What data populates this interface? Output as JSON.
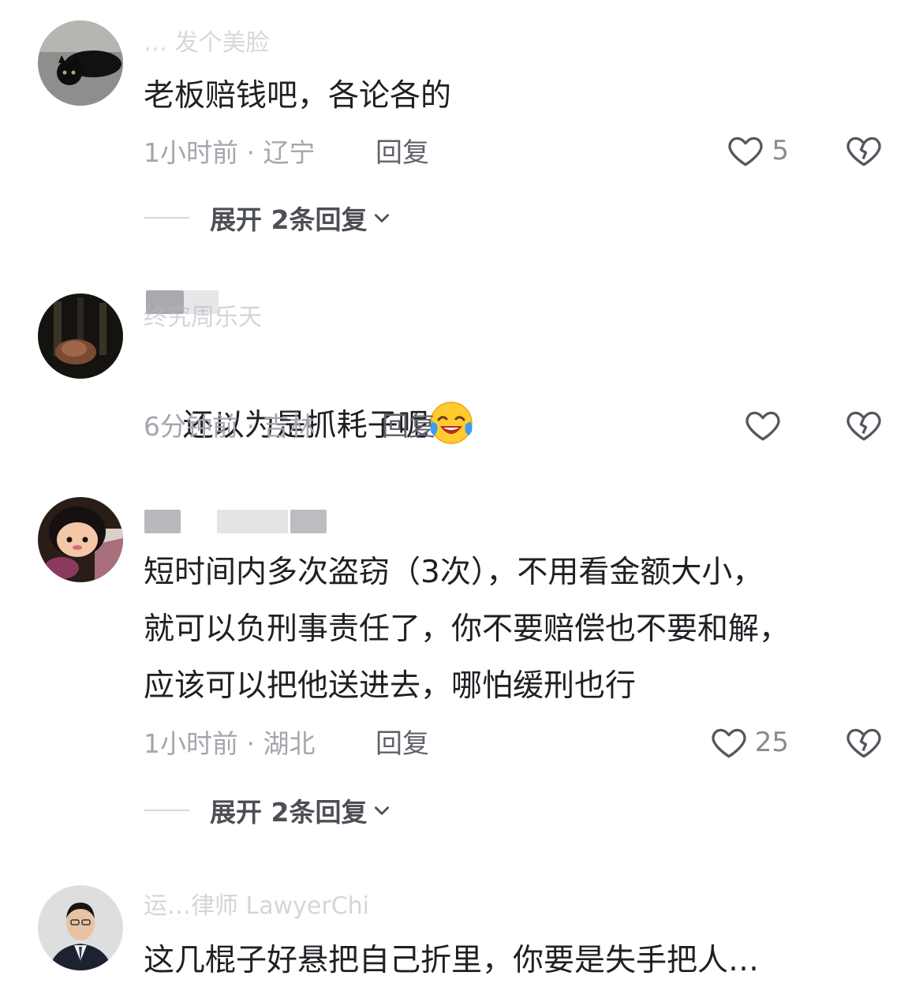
{
  "comments": [
    {
      "username": "… 发个美脸",
      "text": "老板赔钱吧，各论各的",
      "time_location": "1小时前 · 辽宁",
      "reply_label": "回复",
      "likes": "5",
      "expand_label": "展开 2条回复"
    },
    {
      "username": "终究周乐天",
      "text": "还以为是抓耗子呢",
      "emoji": "face-crying-laughing",
      "time_location": "6分钟前 · 吉林",
      "reply_label": "回复",
      "likes": ""
    },
    {
      "username": "",
      "text": "短时间内多次盗窃（3次），不用看金额大小，\n就可以负刑事责任了，你不要赔偿也不要和解，\n应该可以把他送进去，哪怕缓刑也行",
      "time_location": "1小时前 · 湖北",
      "reply_label": "回复",
      "likes": "25",
      "expand_label": "展开 2条回复"
    },
    {
      "username": "运…律师 LawyerChi",
      "text": "这几棍子好悬把自己折里，你要是失手把人…"
    }
  ],
  "icons": {
    "like": "heart-outline-icon",
    "dislike": "broken-heart-icon",
    "expand": "chevron-down-icon"
  },
  "colors": {
    "text": "#1f1f24",
    "meta": "#a5a6ad",
    "reply": "#60626b",
    "username": "#b9bac0"
  }
}
